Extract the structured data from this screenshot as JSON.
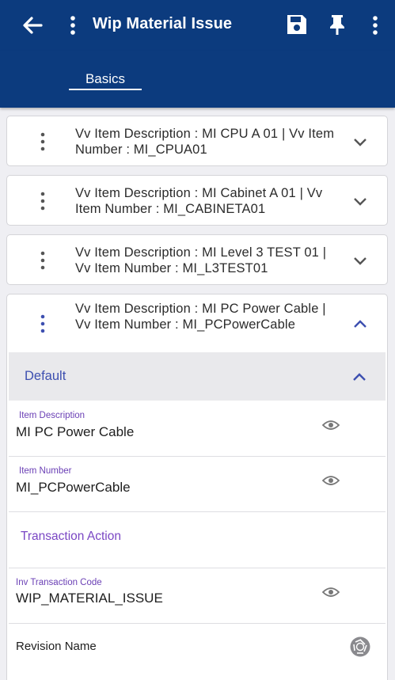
{
  "app_bar": {
    "title": "Wip Material Issue",
    "icons": [
      "back-arrow-icon",
      "more-vert-icon",
      "save-icon",
      "pin-icon",
      "more-vert-icon"
    ]
  },
  "tabs": [
    {
      "label": "Basics",
      "selected": true
    }
  ],
  "records": [
    {
      "text": "Vv Item Description  : MI CPU A 01 | Vv Item Number  : MI_CPUA01",
      "expanded": false
    },
    {
      "text": "Vv Item Description  : MI Cabinet A 01 | Vv Item Number  : MI_CABINETA01",
      "expanded": false
    },
    {
      "text": "Vv Item Description  : MI Level 3 TEST 01 | Vv Item Number  : MI_L3TEST01",
      "expanded": false
    },
    {
      "text": "Vv Item Description  : MI PC Power Cable | Vv Item Number  : MI_PCPowerCable",
      "expanded": true
    }
  ],
  "detail": {
    "section_label": "Default",
    "fields": [
      {
        "label": "Item Description",
        "value": "MI PC Power Cable"
      },
      {
        "label": "Item Number",
        "value": "MI_PCPowerCable"
      }
    ],
    "subheading": "Transaction Action",
    "transaction_field": {
      "label": "Inv Transaction Code",
      "value": "WIP_MATERIAL_ISSUE"
    },
    "revision_label": "Revision Name"
  },
  "colors": {
    "primary": "#0c3b7e",
    "accent_blue": "#3d4fb0",
    "accent_purple": "#6a3fb5"
  }
}
